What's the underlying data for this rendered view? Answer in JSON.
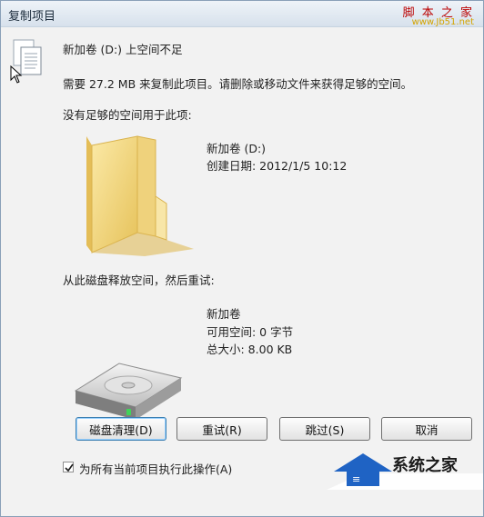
{
  "window": {
    "title": "复制项目",
    "watermark_top": "脚 本 之 家",
    "watermark_url": "www.Jb51.net"
  },
  "message": {
    "headline": "新加卷 (D:) 上空间不足",
    "detail": "需要 27.2 MB 来复制此项目。请删除或移动文件来获得足够的空间。",
    "section_items": "没有足够的空间用于此项:"
  },
  "item": {
    "name": "新加卷 (D:)",
    "created": "创建日期: 2012/1/5 10:12"
  },
  "free_space": {
    "section": "从此磁盘释放空间，然后重试:",
    "drive_name": "新加卷",
    "available": "可用空间: 0 字节",
    "total": "总大小: 8.00 KB"
  },
  "buttons": {
    "disk_cleanup": "磁盘清理(D)",
    "retry": "重试(R)",
    "skip": "跳过(S)",
    "cancel": "取消"
  },
  "option": {
    "label": "为所有当前项目执行此操作(A)",
    "checked": true
  },
  "brand": {
    "text": "系统之家"
  },
  "colors": {
    "folder": "#f2d77a",
    "accent": "#3c7fb1",
    "brand_blue": "#1f63c4"
  }
}
